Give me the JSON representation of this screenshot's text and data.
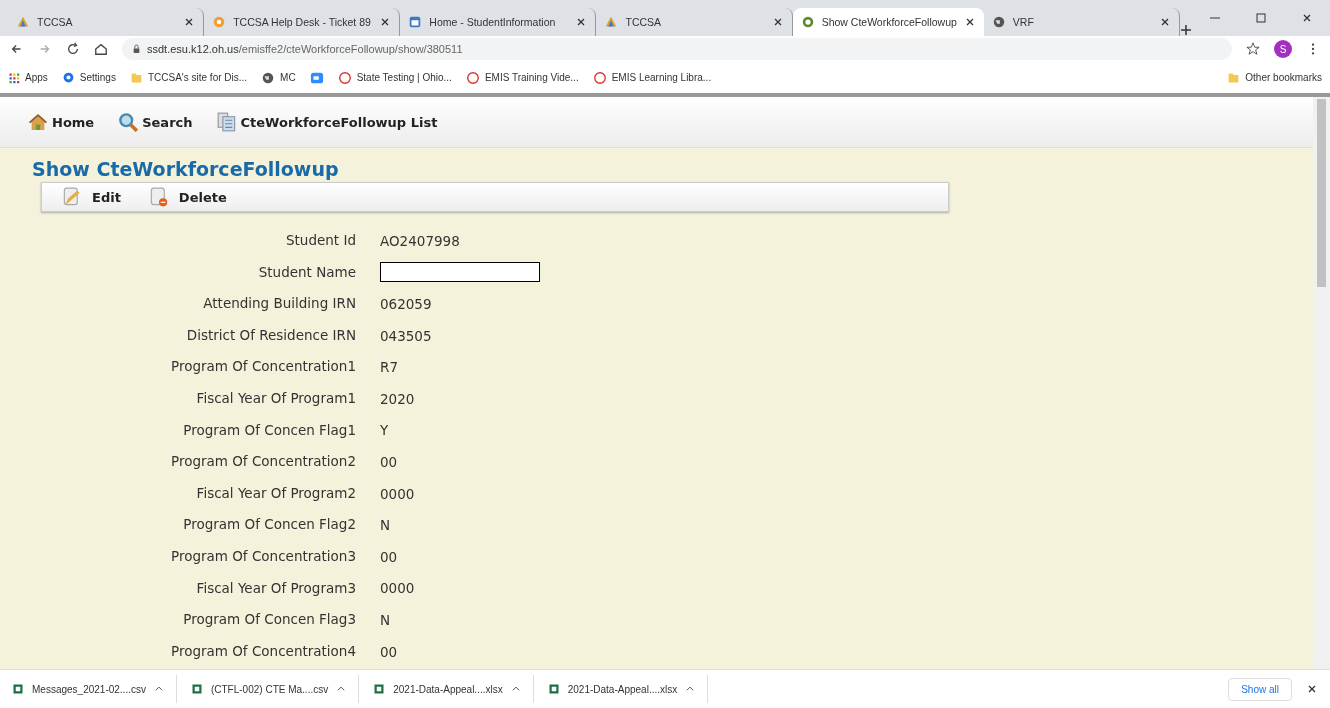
{
  "browser": {
    "tabs": [
      {
        "title": "TCCSA",
        "selected": false
      },
      {
        "title": "TCCSA Help Desk - Ticket 89",
        "selected": false
      },
      {
        "title": "Home - StudentInformation",
        "selected": false
      },
      {
        "title": "TCCSA",
        "selected": false
      },
      {
        "title": "Show CteWorkforceFollowup",
        "selected": true
      },
      {
        "title": "VRF",
        "selected": false
      }
    ],
    "address": {
      "host": "ssdt.esu.k12.oh.us",
      "path": "/emisffe2/cteWorkforceFollowup/show/380511"
    },
    "profile_initial": "S",
    "bookmarks": [
      {
        "label": "Apps"
      },
      {
        "label": "Settings"
      },
      {
        "label": "TCCSA's site for Dis..."
      },
      {
        "label": "MC"
      },
      {
        "label": "State Testing | Ohio..."
      },
      {
        "label": "EMIS Training Vide..."
      },
      {
        "label": "EMIS Learning Libra..."
      }
    ],
    "other_bookmarks": "Other bookmarks"
  },
  "nav": [
    {
      "label": "Home"
    },
    {
      "label": "Search"
    },
    {
      "label": "CteWorkforceFollowup List"
    }
  ],
  "title": "Show CteWorkforceFollowup",
  "actions": [
    {
      "label": "Edit"
    },
    {
      "label": "Delete"
    }
  ],
  "fields": [
    {
      "label": "Student Id",
      "value": "AO2407998"
    },
    {
      "label": "Student Name"
    },
    {
      "label": "Attending Building IRN",
      "value": "062059"
    },
    {
      "label": "District Of Residence IRN",
      "value": "043505"
    },
    {
      "label": "Program Of Concentration1",
      "value": "R7"
    },
    {
      "label": "Fiscal Year Of Program1",
      "value": "2020"
    },
    {
      "label": "Program Of Concen Flag1",
      "value": "Y"
    },
    {
      "label": "Program Of Concentration2",
      "value": "00"
    },
    {
      "label": "Fiscal Year Of Program2",
      "value": "0000"
    },
    {
      "label": "Program Of Concen Flag2",
      "value": "N"
    },
    {
      "label": "Program Of Concentration3",
      "value": "00"
    },
    {
      "label": "Fiscal Year Of Program3",
      "value": "0000"
    },
    {
      "label": "Program Of Concen Flag3",
      "value": "N"
    },
    {
      "label": "Program Of Concentration4",
      "value": "00"
    }
  ],
  "downloads": [
    {
      "name": "Messages_2021-02....csv"
    },
    {
      "name": "(CTFL-002) CTE Ma....csv"
    },
    {
      "name": "2021-Data-Appeal....xlsx"
    },
    {
      "name": "2021-Data-Appeal....xlsx"
    }
  ],
  "show_all": "Show all"
}
